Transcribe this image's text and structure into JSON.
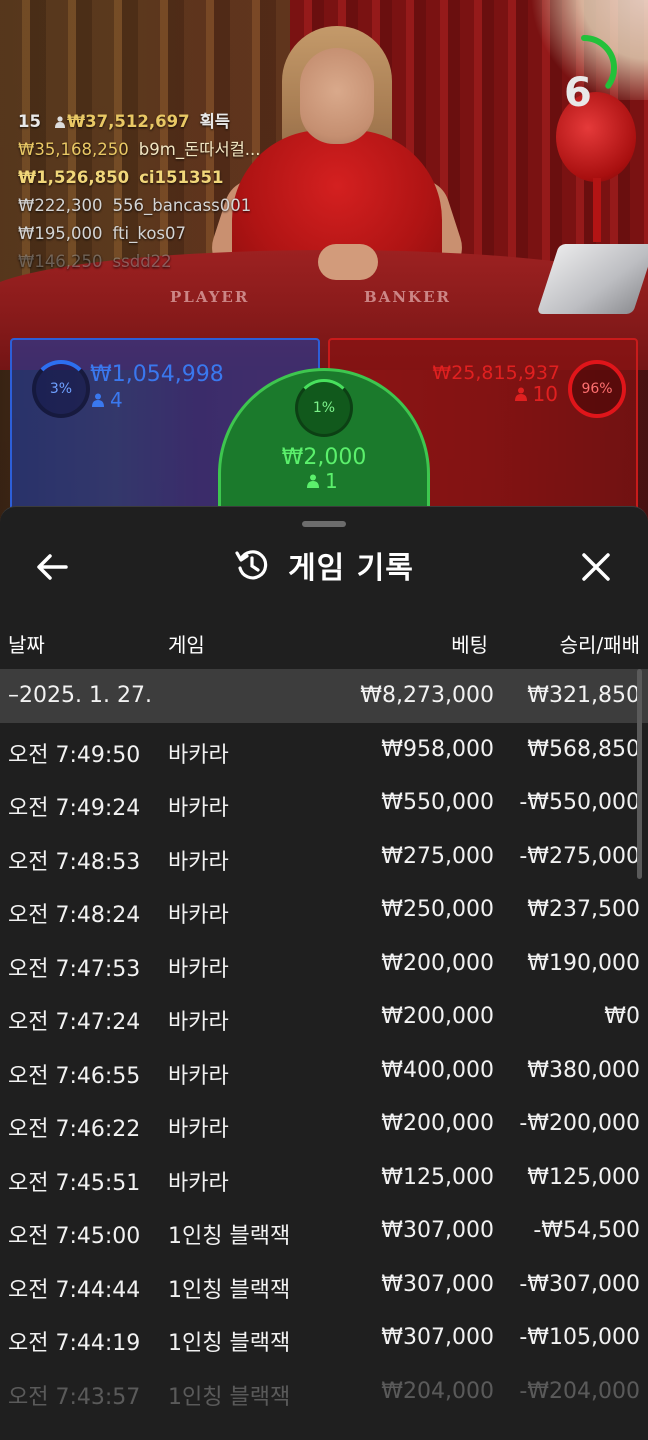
{
  "stage": {
    "table_labels": {
      "player": "PLAYER",
      "banker": "BANKER"
    },
    "timer": {
      "value": "6",
      "progress": 0.35,
      "color": "#22c13a"
    }
  },
  "winners": {
    "header": {
      "count": "15",
      "total": "₩37,512,697",
      "suffix": "획득"
    },
    "list": [
      {
        "amount": "₩35,168,250",
        "name": "b9m_돈따서컬..."
      },
      {
        "amount": "₩1,526,850",
        "name": "ci151351"
      },
      {
        "amount": "₩222,300",
        "name": "556_bancass001"
      },
      {
        "amount": "₩195,000",
        "name": "fti_kos07"
      },
      {
        "amount": "₩146,250",
        "name": "ssdd22"
      }
    ]
  },
  "bets": {
    "player": {
      "percent": "3%",
      "amount": "₩1,054,998",
      "players": "4",
      "color": "#2d6ff0"
    },
    "banker": {
      "percent": "96%",
      "amount": "₩25,815,937",
      "players": "10",
      "color": "#e0151a"
    },
    "tie": {
      "percent": "1%",
      "amount": "₩2,000",
      "players": "1",
      "color": "#48e05d"
    }
  },
  "history": {
    "title": "게임 기록",
    "columns": {
      "date": "날짜",
      "game": "게임",
      "bet": "베팅",
      "result": "승리/패배"
    },
    "summary": {
      "date": "–2025. 1. 27.",
      "bet": "₩8,273,000",
      "result": "₩321,850"
    },
    "rows": [
      {
        "time": "오전 7:49:50",
        "game": "바카라",
        "bet": "₩958,000",
        "result": "₩568,850"
      },
      {
        "time": "오전 7:49:24",
        "game": "바카라",
        "bet": "₩550,000",
        "result": "-₩550,000"
      },
      {
        "time": "오전 7:48:53",
        "game": "바카라",
        "bet": "₩275,000",
        "result": "-₩275,000"
      },
      {
        "time": "오전 7:48:24",
        "game": "바카라",
        "bet": "₩250,000",
        "result": "₩237,500"
      },
      {
        "time": "오전 7:47:53",
        "game": "바카라",
        "bet": "₩200,000",
        "result": "₩190,000"
      },
      {
        "time": "오전 7:47:24",
        "game": "바카라",
        "bet": "₩200,000",
        "result": "₩0"
      },
      {
        "time": "오전 7:46:55",
        "game": "바카라",
        "bet": "₩400,000",
        "result": "₩380,000"
      },
      {
        "time": "오전 7:46:22",
        "game": "바카라",
        "bet": "₩200,000",
        "result": "-₩200,000"
      },
      {
        "time": "오전 7:45:51",
        "game": "바카라",
        "bet": "₩125,000",
        "result": "₩125,000"
      },
      {
        "time": "오전 7:45:00",
        "game": "1인칭 블랙잭",
        "bet": "₩307,000",
        "result": "-₩54,500"
      },
      {
        "time": "오전 7:44:44",
        "game": "1인칭 블랙잭",
        "bet": "₩307,000",
        "result": "-₩307,000"
      },
      {
        "time": "오전 7:44:19",
        "game": "1인칭 블랙잭",
        "bet": "₩307,000",
        "result": "-₩105,000"
      },
      {
        "time": "오전 7:43:57",
        "game": "1인칭 블랙잭",
        "bet": "₩204,000",
        "result": "-₩204,000"
      }
    ]
  }
}
